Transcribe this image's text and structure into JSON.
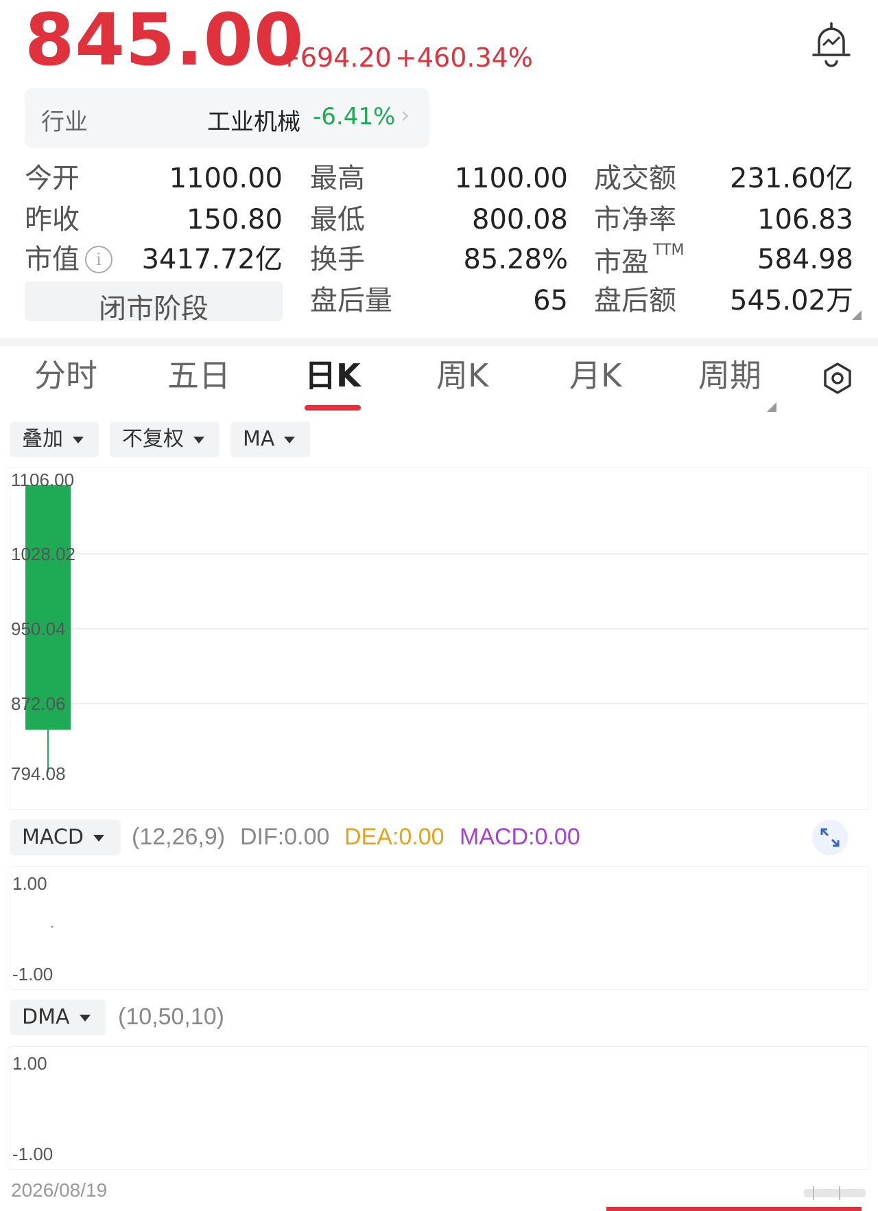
{
  "quote": {
    "price": "845.00",
    "change": "+694.20",
    "change_pct": "+460.34%"
  },
  "industry": {
    "label": "行业",
    "name": "工业机械",
    "change": "-6.41%"
  },
  "stats": {
    "open_label": "今开",
    "open": "1100.00",
    "prev_close_label": "昨收",
    "prev_close": "150.80",
    "market_cap_label": "市值",
    "market_cap": "3417.72亿",
    "high_label": "最高",
    "high": "1100.00",
    "low_label": "最低",
    "low": "800.08",
    "turnover_label": "换手",
    "turnover": "85.28%",
    "after_vol_label": "盘后量",
    "after_vol": "65",
    "amount_label": "成交额",
    "amount": "231.60亿",
    "pb_label": "市净率",
    "pb": "106.83",
    "pe_label": "市盈",
    "pe_sup": "TTM",
    "pe": "584.98",
    "after_amount_label": "盘后额",
    "after_amount": "545.02万"
  },
  "status_badge": "闭市阶段",
  "tabs": [
    {
      "label": "分时",
      "active": false
    },
    {
      "label": "五日",
      "active": false
    },
    {
      "label": "日K",
      "active": true
    },
    {
      "label": "周K",
      "active": false
    },
    {
      "label": "月K",
      "active": false
    },
    {
      "label": "周期",
      "active": false
    }
  ],
  "toolbar": {
    "overlay": "叠加",
    "adjust": "不复权",
    "indicator": "MA"
  },
  "chart_data": {
    "type": "candlestick",
    "y_ticks": [
      "1106.00",
      "1028.02",
      "950.04",
      "872.06",
      "794.08"
    ],
    "ylim": [
      794.08,
      1106.0
    ],
    "candles": [
      {
        "date": "2026/08/19",
        "open": 1100.0,
        "high": 1100.0,
        "low": 800.08,
        "close": 845.0
      }
    ],
    "colors": {
      "down": "#1faa55",
      "up": "#e0323c"
    }
  },
  "macd": {
    "name": "MACD",
    "params": "(12,26,9)",
    "dif": "DIF:0.00",
    "dea": "DEA:0.00",
    "macd": "MACD:0.00",
    "y_top": "1.00",
    "y_bottom": "-1.00",
    "colors": {
      "dif": "#888888",
      "dea": "#e6a21a",
      "macd": "#a83fd6"
    }
  },
  "dma": {
    "name": "DMA",
    "params": "(10,50,10)",
    "y_top": "1.00",
    "y_bottom": "-1.00"
  },
  "date_label": "2026/08/19"
}
